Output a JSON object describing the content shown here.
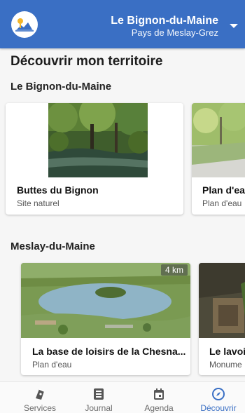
{
  "header": {
    "town_name": "Le Bignon-du-Maine",
    "community": "Pays de Meslay-Grez",
    "accent_color": "#3a6fc4",
    "logo_icon": "town-logo-icon",
    "dropdown_icon": "chevron-down-icon"
  },
  "main": {
    "title": "Découvrir mon territoire",
    "sections": [
      {
        "title": "Le Bignon-du-Maine",
        "cards": [
          {
            "title": "Buttes du Bignon",
            "type": "Site naturel"
          },
          {
            "title": "Plan d'ea",
            "type": "Plan d'eau"
          }
        ]
      },
      {
        "title": "Meslay-du-Maine",
        "cards": [
          {
            "title": "La base de loisirs de la Chesna...",
            "type": "Plan d'eau",
            "distance": "4 km"
          },
          {
            "title": "Le lavoi",
            "type": "Monume"
          }
        ]
      }
    ]
  },
  "bottom_nav": {
    "items": [
      {
        "label": "Services",
        "icon": "services-icon"
      },
      {
        "label": "Journal",
        "icon": "journal-icon"
      },
      {
        "label": "Agenda",
        "icon": "calendar-icon"
      },
      {
        "label": "Découvrir",
        "icon": "compass-icon",
        "active": true
      }
    ]
  }
}
